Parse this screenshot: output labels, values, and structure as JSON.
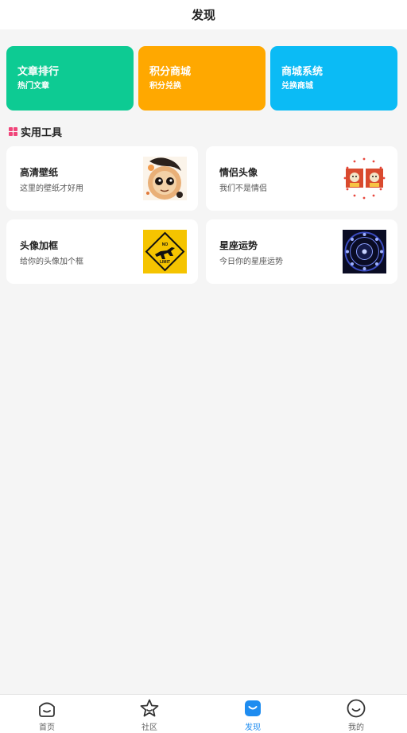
{
  "header": {
    "title": "发现"
  },
  "cards": [
    {
      "title": "文章排行",
      "subtitle": "热门文章",
      "color": "#0dcb93"
    },
    {
      "title": "积分商城",
      "subtitle": "积分兑换",
      "color": "#ffa800"
    },
    {
      "title": "商城系统",
      "subtitle": "兑换商城",
      "color": "#0bbbf5"
    }
  ],
  "section": {
    "title": "实用工具",
    "icon": "grid-icon",
    "icon_color": "#f0457a"
  },
  "tools": [
    {
      "title": "高清壁纸",
      "subtitle": "这里的壁纸才好用",
      "image": "wallpaper-thumbnail"
    },
    {
      "title": "情侣头像",
      "subtitle": "我们不是情侣",
      "image": "couple-avatar-thumbnail"
    },
    {
      "title": "头像加框",
      "subtitle": "给你的头像加个框",
      "image": "avatar-frame-thumbnail",
      "image_text": [
        "NO",
        "LIMIT"
      ]
    },
    {
      "title": "星座运势",
      "subtitle": "今日你的星座运势",
      "image": "horoscope-thumbnail"
    }
  ],
  "nav": {
    "active_color": "#1e8cf0",
    "items": [
      {
        "label": "首页",
        "icon": "home-icon"
      },
      {
        "label": "社区",
        "icon": "star-icon"
      },
      {
        "label": "发现",
        "icon": "discover-bag-icon",
        "active": true
      },
      {
        "label": "我的",
        "icon": "smile-icon"
      }
    ]
  }
}
